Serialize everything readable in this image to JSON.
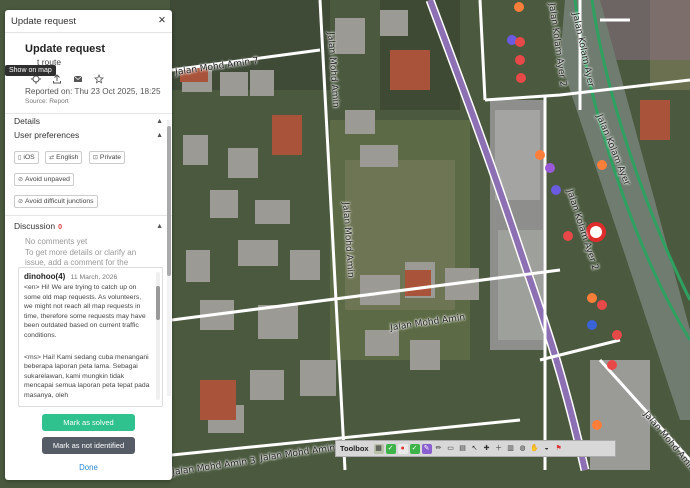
{
  "panel": {
    "header_title": "Update request",
    "close_symbol": "✕",
    "request_title": "Update request",
    "request_subtitle": "t route",
    "tooltip": "Show on map",
    "action_icons": [
      "target-icon",
      "share-icon",
      "mail-icon",
      "star-icon"
    ],
    "reported": "Reported on: Thu 23 Oct 2025, 18:25",
    "source": "Source: Report",
    "details_label": "Details",
    "prefs_label": "User preferences",
    "chips": [
      {
        "icon": "phone-icon",
        "label": "iOS"
      },
      {
        "icon": "translate-icon",
        "label": "English"
      },
      {
        "icon": "lock-icon",
        "label": "Private"
      },
      {
        "icon": "avoid-icon",
        "label": "Avoid unpaved"
      },
      {
        "icon": "avoid-icon",
        "label": "Avoid difficult junctions"
      }
    ],
    "discussion_label": "Discussion",
    "discussion_count": "0",
    "no_comments": "No comments yet",
    "prompt": "To get more details or clarify an issue, add a comment for the reporter.",
    "comment": {
      "author": "dinohoo(4)",
      "date": "11 March, 2026",
      "para1": "<en> Hi! We are trying to catch up on some old map requests. As volunteers, we might not reach all map requests in time, therefore some requests may have been outdated based on current traffic conditions.",
      "para2": "<ms> Hai! Kami sedang cuba menangani beberapa laporan peta lama. Sebagai sukarelawan, kami mungkin tidak mencapai semua laporan peta tepat pada masanya, oleh"
    },
    "btn_solved": "Mark as solved",
    "btn_not_identified": "Mark as not identified",
    "done": "Done"
  },
  "map": {
    "road_labels": [
      {
        "text": "Jalan Mohd Amin 7"
      },
      {
        "text": "Jalan Mohd Amin"
      },
      {
        "text": "Jalan Mohd Amin"
      },
      {
        "text": "Jalan Mohd Amin"
      },
      {
        "text": "Jalan Mohd Amin 5"
      },
      {
        "text": "Jalan Mohd Amin 3"
      },
      {
        "text": "Jalan Kolam Ayer 2"
      },
      {
        "text": "Jalan Kolam Ayer 2"
      },
      {
        "text": "Jalan Kolam Ayer"
      },
      {
        "text": "Jalan Kolam Ayer"
      },
      {
        "text": "Jalan Mohd Amin 3"
      }
    ]
  },
  "toolbox": {
    "label": "Toolbox",
    "tools": [
      "layer-icon",
      "green-check-icon",
      "alert-icon",
      "check-icon",
      "purple-icon",
      "pencil-icon",
      "ruler-icon",
      "grid-icon",
      "cursor-icon",
      "cross-icon",
      "plus-icon",
      "map-icon",
      "globe-icon",
      "hand-icon",
      "chat-icon",
      "flag-icon"
    ]
  }
}
